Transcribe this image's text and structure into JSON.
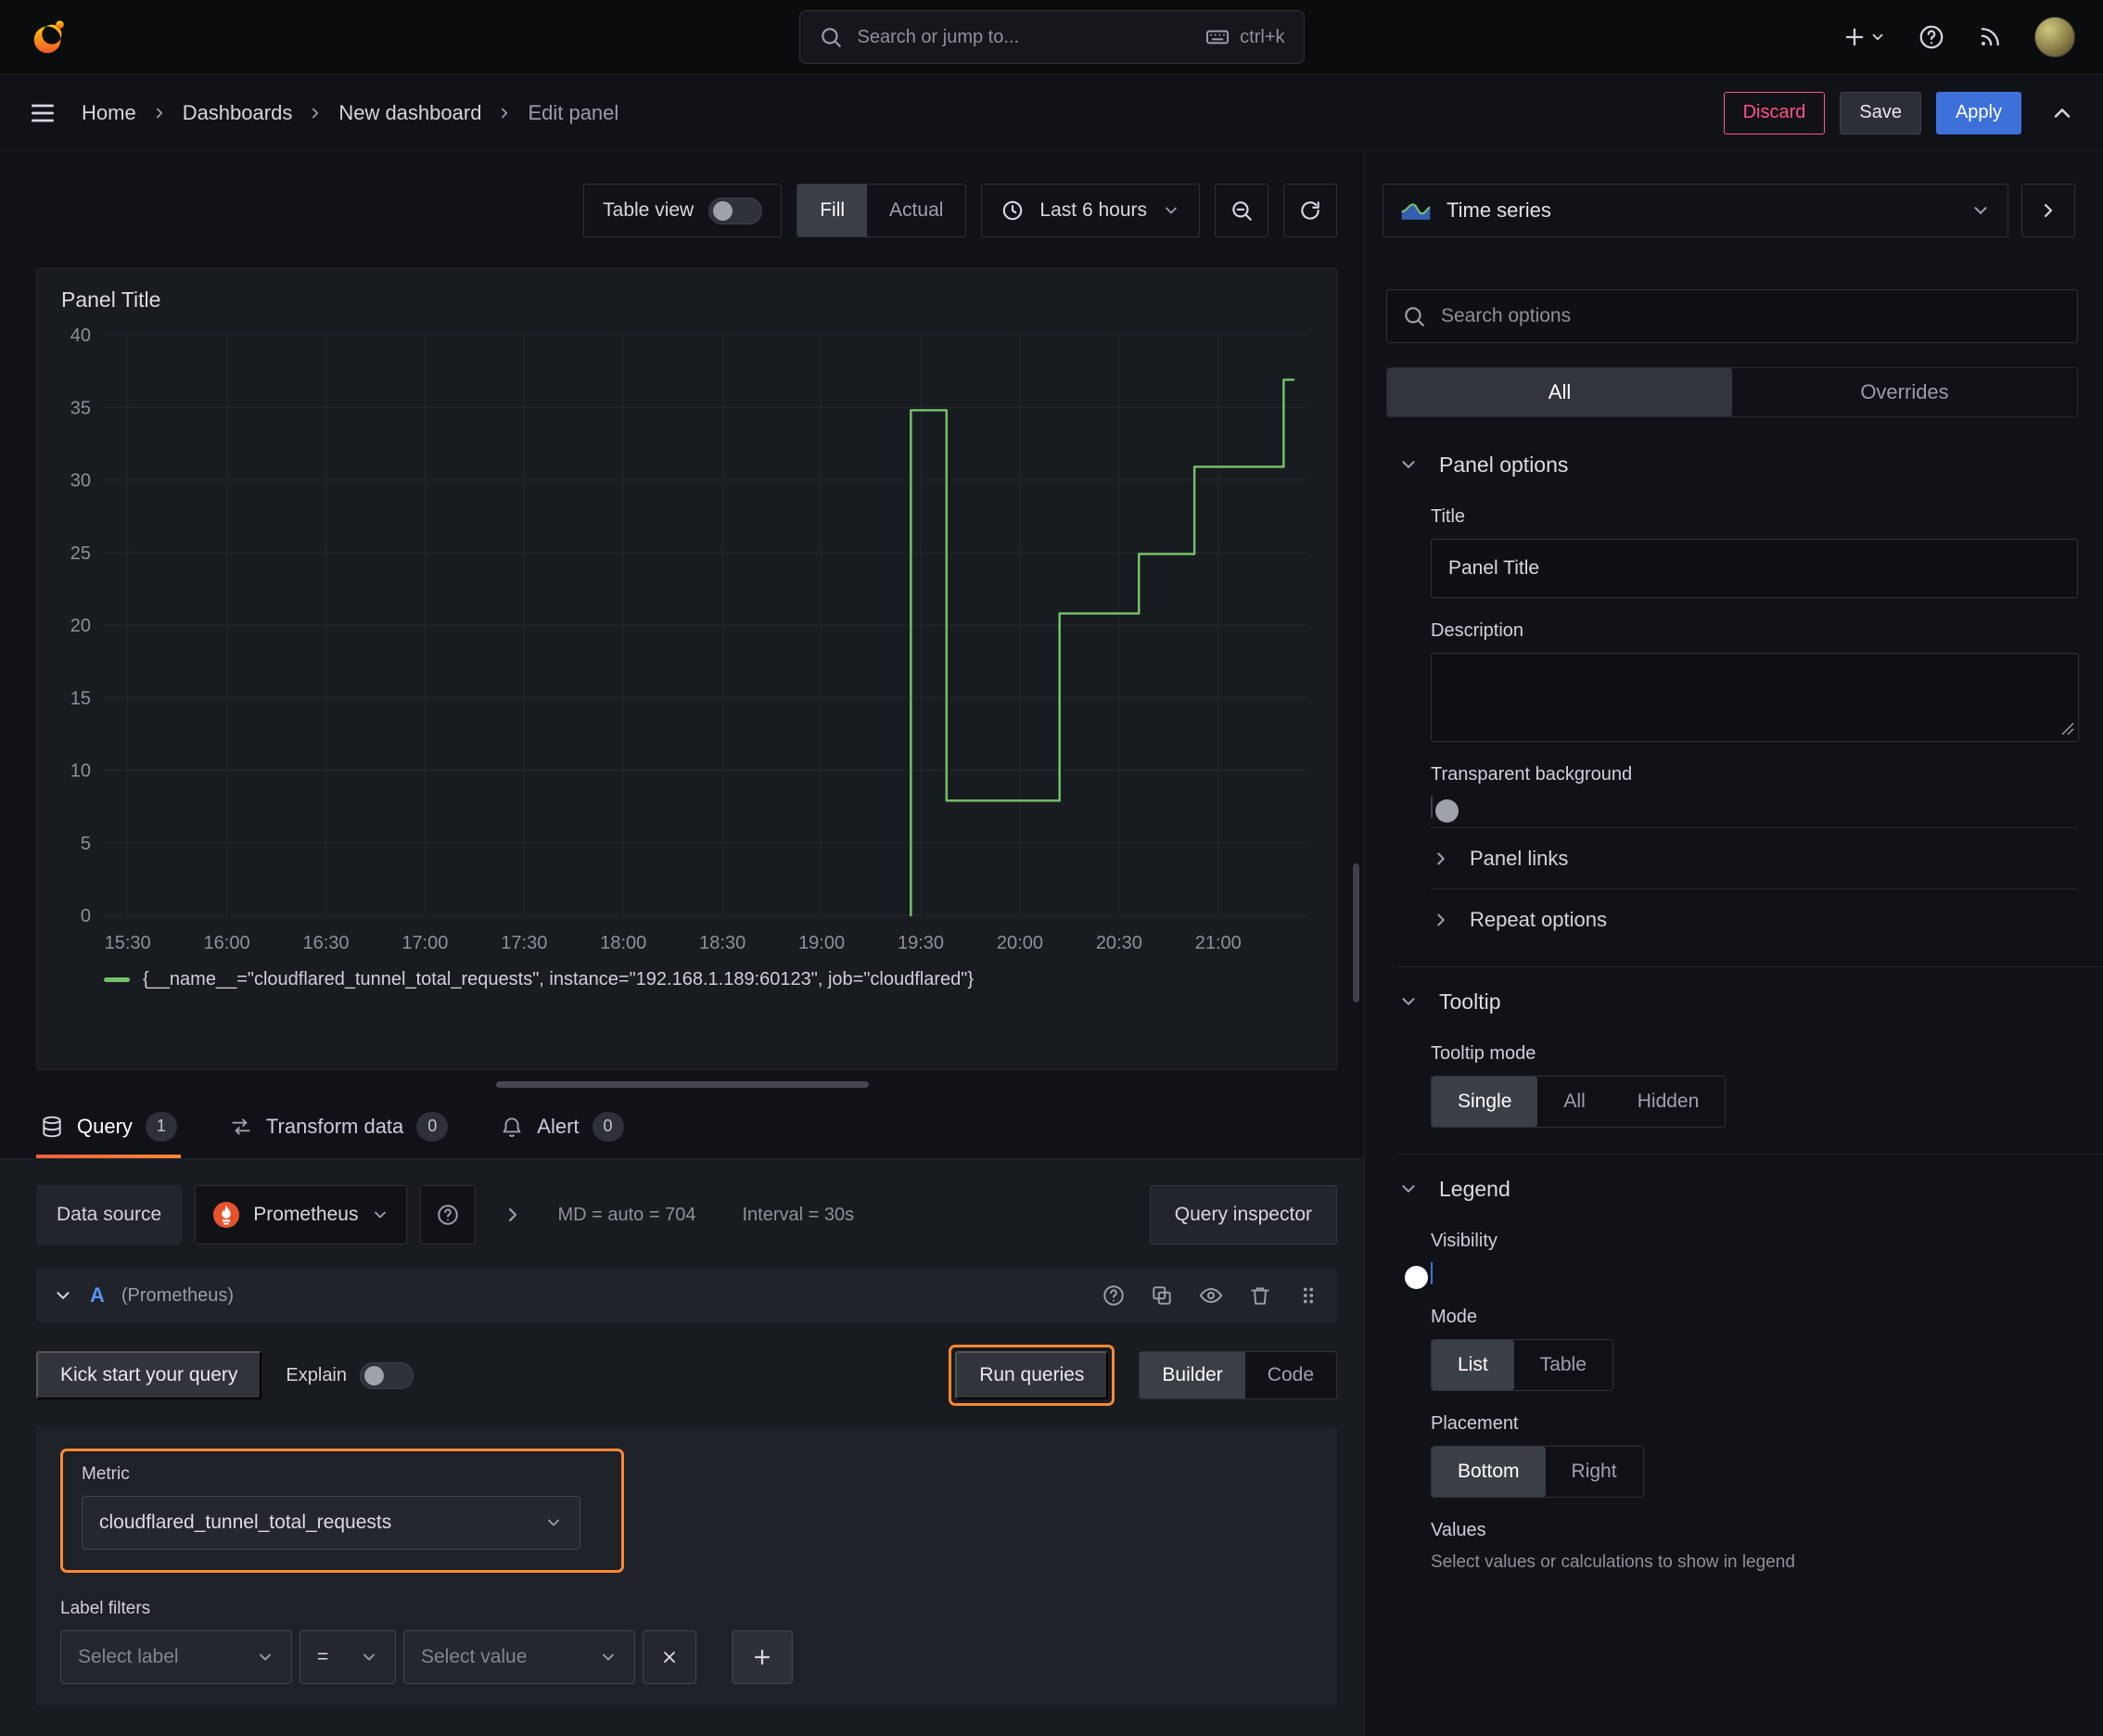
{
  "topbar": {
    "search_placeholder": "Search or jump to...",
    "shortcut": "ctrl+k"
  },
  "nav": {
    "breadcrumbs": [
      "Home",
      "Dashboards",
      "New dashboard",
      "Edit panel"
    ],
    "discard": "Discard",
    "save": "Save",
    "apply": "Apply"
  },
  "toolbar": {
    "table_view": "Table view",
    "fill": "Fill",
    "actual": "Actual",
    "time_range": "Last 6 hours"
  },
  "panel": {
    "title": "Panel Title"
  },
  "chart_data": {
    "type": "line",
    "title": "Panel Title",
    "xlabel": "",
    "ylabel": "",
    "xlim": [
      15.38,
      21.45
    ],
    "ylim": [
      0,
      40
    ],
    "grid": true,
    "legend_position": "bottom",
    "y_ticks": [
      0,
      5,
      10,
      15,
      20,
      25,
      30,
      35,
      40
    ],
    "x_ticks": [
      {
        "v": 15.5,
        "label": "15:30"
      },
      {
        "v": 16.0,
        "label": "16:00"
      },
      {
        "v": 16.5,
        "label": "16:30"
      },
      {
        "v": 17.0,
        "label": "17:00"
      },
      {
        "v": 17.5,
        "label": "17:30"
      },
      {
        "v": 18.0,
        "label": "18:00"
      },
      {
        "v": 18.5,
        "label": "18:30"
      },
      {
        "v": 19.0,
        "label": "19:00"
      },
      {
        "v": 19.5,
        "label": "19:30"
      },
      {
        "v": 20.0,
        "label": "20:00"
      },
      {
        "v": 20.5,
        "label": "20:30"
      },
      {
        "v": 21.0,
        "label": "21:00"
      }
    ],
    "series": [
      {
        "name": "{__name__=\"cloudflared_tunnel_total_requests\", instance=\"192.168.1.189:60123\", job=\"cloudflared\"}",
        "color": "#73bf69",
        "points": [
          [
            19.45,
            0
          ],
          [
            19.45,
            34.8
          ],
          [
            19.63,
            34.8
          ],
          [
            19.63,
            7.9
          ],
          [
            20.2,
            7.9
          ],
          [
            20.2,
            20.8
          ],
          [
            20.6,
            20.8
          ],
          [
            20.6,
            24.9
          ],
          [
            20.88,
            24.9
          ],
          [
            20.88,
            30.9
          ],
          [
            21.33,
            30.9
          ],
          [
            21.33,
            36.9
          ],
          [
            21.38,
            36.9
          ]
        ]
      }
    ]
  },
  "tabs": {
    "query": "Query",
    "query_count": "1",
    "transform": "Transform data",
    "transform_count": "0",
    "alert": "Alert",
    "alert_count": "0"
  },
  "query": {
    "datasource_label": "Data source",
    "datasource_name": "Prometheus",
    "stats_md": "MD = auto = 704",
    "stats_interval": "Interval = 30s",
    "inspector": "Query inspector",
    "ref_id": "A",
    "ref_ds": "(Prometheus)",
    "kickstart": "Kick start your query",
    "explain": "Explain",
    "run_queries": "Run queries",
    "builder": "Builder",
    "code": "Code",
    "metric_label": "Metric",
    "metric_value": "cloudflared_tunnel_total_requests",
    "label_filters": "Label filters",
    "select_label_placeholder": "Select label",
    "operator": "=",
    "select_value_placeholder": "Select value"
  },
  "options": {
    "viz_type": "Time series",
    "search_placeholder": "Search options",
    "tab_all": "All",
    "tab_overrides": "Overrides",
    "panel_options": "Panel options",
    "title_label": "Title",
    "title_value": "Panel Title",
    "description_label": "Description",
    "transparent_bg": "Transparent background",
    "panel_links": "Panel links",
    "repeat_options": "Repeat options",
    "tooltip": "Tooltip",
    "tooltip_mode": "Tooltip mode",
    "tooltip_single": "Single",
    "tooltip_all": "All",
    "tooltip_hidden": "Hidden",
    "legend": "Legend",
    "visibility": "Visibility",
    "mode": "Mode",
    "mode_list": "List",
    "mode_table": "Table",
    "placement": "Placement",
    "placement_bottom": "Bottom",
    "placement_right": "Right",
    "values": "Values",
    "values_hint": "Select values or calculations to show in legend"
  },
  "colors": {
    "accent_orange": "#ff8833",
    "primary_blue": "#3d71d9",
    "series_green": "#73bf69",
    "destructive_pink": "#ff5286",
    "prometheus_orange": "#e6522c"
  }
}
